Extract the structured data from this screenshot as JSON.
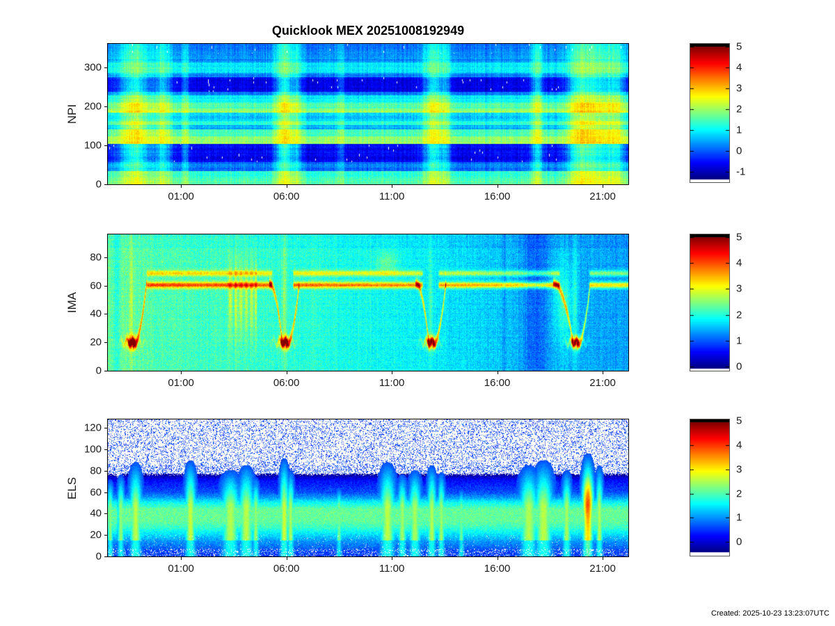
{
  "title": "Quicklook MEX 20251008192949",
  "created": "Created: 2025-10-23 13:23:07UTC",
  "time_axis": {
    "start_hours": -2.47,
    "end_hours": 22.22,
    "ticks": [
      {
        "t": 1,
        "label": "01:00"
      },
      {
        "t": 6,
        "label": "06:00"
      },
      {
        "t": 11,
        "label": "11:00"
      },
      {
        "t": 16,
        "label": "16:00"
      },
      {
        "t": 21,
        "label": "21:00"
      }
    ]
  },
  "chart_data": [
    {
      "type": "heatmap",
      "ylabel": "NPI",
      "y_range": [
        0,
        360
      ],
      "y_ticks": [
        0,
        100,
        200,
        300
      ],
      "colorbar": {
        "vmin": -1.5,
        "vmax": 5.15,
        "cap_hi": 5.0,
        "cap_lo": -1.36,
        "ticks": [
          5,
          4,
          3,
          2,
          1,
          0,
          -1
        ],
        "colormap": "jet",
        "over_color": "#000000",
        "under_color": "#ffffff"
      },
      "render": {
        "kind": "npi",
        "bands": [
          [
            0,
            17,
            1.45
          ],
          [
            17,
            34,
            1.2
          ],
          [
            34,
            57,
            0.1
          ],
          [
            57,
            103,
            -0.75
          ],
          [
            103,
            123,
            2.0
          ],
          [
            123,
            140,
            1.5
          ],
          [
            140,
            151,
            0.45
          ],
          [
            151,
            163,
            1.3
          ],
          [
            163,
            183,
            0.6
          ],
          [
            183,
            194,
            1.9
          ],
          [
            194,
            211,
            1.5
          ],
          [
            211,
            228,
            0.9
          ],
          [
            228,
            237,
            0.0
          ],
          [
            237,
            274,
            -0.8
          ],
          [
            274,
            286,
            0.2
          ],
          [
            286,
            311,
            0.9
          ],
          [
            311,
            346,
            0.25
          ],
          [
            346,
            360,
            0.05
          ]
        ],
        "events": [
          {
            "t": -1.2,
            "w": 0.55,
            "s": 1.5
          },
          {
            "t": 0.15,
            "w": 0.28,
            "s": 1.1
          },
          {
            "t": 1.2,
            "w": 0.12,
            "s": 0.8
          },
          {
            "t": 5.9,
            "w": 0.3,
            "s": 1.5
          },
          {
            "t": 6.5,
            "w": 0.16,
            "s": 0.8
          },
          {
            "t": 8.6,
            "w": 0.12,
            "s": 0.6
          },
          {
            "t": 13.0,
            "w": 0.35,
            "s": 1.4
          },
          {
            "t": 13.6,
            "w": 0.14,
            "s": 0.7
          },
          {
            "t": 17.9,
            "w": 0.22,
            "s": 1.1
          },
          {
            "t": 19.9,
            "w": 0.45,
            "s": 1.5
          },
          {
            "t": 20.9,
            "w": 0.5,
            "s": 1.2
          },
          {
            "t": 21.7,
            "w": 0.3,
            "s": 1.0
          }
        ]
      }
    },
    {
      "type": "heatmap",
      "ylabel": "IMA",
      "y_range": [
        0,
        96
      ],
      "y_ticks": [
        0,
        20,
        40,
        60,
        80
      ],
      "colorbar": {
        "vmin": -0.15,
        "vmax": 5.1,
        "cap_hi": 5.0,
        "cap_lo": -0.07,
        "ticks": [
          5,
          4,
          3,
          2,
          1,
          0
        ],
        "colormap": "jet",
        "over_color": "#000000",
        "under_color": "#ffffff"
      },
      "render": {
        "kind": "ima",
        "bg": [
          [
            -2.47,
            2.35
          ],
          [
            -1.6,
            2.3
          ],
          [
            0,
            2.2
          ],
          [
            6,
            2.05
          ],
          [
            12,
            1.8
          ],
          [
            16,
            1.55
          ],
          [
            19,
            1.45
          ],
          [
            22.22,
            1.3
          ]
        ],
        "beam_segments": [
          [
            -0.65,
            5.35
          ],
          [
            6.3,
            12.5
          ],
          [
            13.2,
            19.0
          ],
          [
            20.35,
            22.3
          ]
        ],
        "beam_lines": [
          {
            "ch": 68.6,
            "amp": 1.15,
            "sig": 1.4
          },
          {
            "ch": 60.3,
            "amp": 1.95,
            "sig": 1.5
          }
        ],
        "periapsis": [
          {
            "t": -1.35,
            "sides": "r"
          },
          {
            "t": 5.9,
            "sides": "lr"
          },
          {
            "t": 12.85,
            "sides": "lr"
          },
          {
            "t": 19.7,
            "sides": "lr",
            "wide": true
          }
        ],
        "streaks": [
          {
            "t": 3.35,
            "w": 0.06
          },
          {
            "t": 3.6,
            "w": 0.05
          },
          {
            "t": 3.85,
            "w": 0.07
          },
          {
            "t": 4.1,
            "w": 0.05
          },
          {
            "t": 4.35,
            "w": 0.06
          },
          {
            "t": 4.55,
            "w": 0.04
          }
        ],
        "bump": {
          "t": 10.75,
          "w": 0.4,
          "ch": 76,
          "amp": 0.5
        },
        "dark_cols": [
          {
            "t": -2.05,
            "w": 0.1,
            "d": -0.35
          },
          {
            "t": 16.35,
            "w": 0.1,
            "d": -0.25
          },
          {
            "t": 17.8,
            "w": 0.45,
            "d": -0.5
          }
        ]
      }
    },
    {
      "type": "heatmap",
      "ylabel": "ELS",
      "y_range": [
        0,
        128
      ],
      "y_ticks": [
        0,
        20,
        40,
        60,
        80,
        100,
        120
      ],
      "colorbar": {
        "vmin": -0.57,
        "vmax": 5.06,
        "cap_hi": 4.94,
        "cap_lo": -0.44,
        "ticks": [
          5,
          4,
          3,
          2,
          1,
          0
        ],
        "colormap": "jet",
        "over_color": "#000000",
        "under_color": "#ffffff"
      },
      "render": {
        "kind": "els",
        "profile": [
          [
            0,
            0.45
          ],
          [
            5,
            0.5
          ],
          [
            9,
            0.75
          ],
          [
            14,
            0.95
          ],
          [
            20,
            1.35
          ],
          [
            27,
            1.85
          ],
          [
            33,
            2.1
          ],
          [
            44,
            2.1
          ],
          [
            50,
            1.6
          ],
          [
            55,
            1.0
          ],
          [
            60,
            0.55
          ],
          [
            66,
            0.35
          ],
          [
            71,
            0.15
          ],
          [
            75,
            -0.25
          ],
          [
            79,
            -0.8
          ],
          [
            128,
            -1.05
          ]
        ],
        "plumes": [
          {
            "t": -2.35,
            "w": 0.1,
            "top": 70,
            "s": 1.1
          },
          {
            "t": -1.85,
            "w": 0.12,
            "top": 75,
            "s": 1.2
          },
          {
            "t": -1.15,
            "w": 0.2,
            "top": 88,
            "s": 1.6
          },
          {
            "t": 1.45,
            "w": 0.18,
            "top": 90,
            "s": 1.7
          },
          {
            "t": 3.35,
            "w": 0.3,
            "top": 80,
            "s": 1.5
          },
          {
            "t": 4.1,
            "w": 0.25,
            "top": 85,
            "s": 1.6
          },
          {
            "t": 4.55,
            "w": 0.12,
            "top": 72,
            "s": 1.2
          },
          {
            "t": 5.9,
            "w": 0.15,
            "top": 92,
            "s": 1.8
          },
          {
            "t": 6.2,
            "w": 0.12,
            "top": 80,
            "s": 1.4
          },
          {
            "t": 8.5,
            "w": 0.1,
            "top": 62,
            "s": 0.9
          },
          {
            "t": 10.8,
            "w": 0.25,
            "top": 88,
            "s": 1.6
          },
          {
            "t": 11.5,
            "w": 0.15,
            "top": 75,
            "s": 1.3
          },
          {
            "t": 12.1,
            "w": 0.2,
            "top": 80,
            "s": 1.4
          },
          {
            "t": 12.9,
            "w": 0.15,
            "top": 85,
            "s": 1.5
          },
          {
            "t": 13.35,
            "w": 0.12,
            "top": 78,
            "s": 1.3
          },
          {
            "t": 14.3,
            "w": 0.1,
            "top": 60,
            "s": 0.8
          },
          {
            "t": 17.5,
            "w": 0.3,
            "top": 85,
            "s": 1.5
          },
          {
            "t": 18.2,
            "w": 0.3,
            "top": 90,
            "s": 1.6
          },
          {
            "t": 19.3,
            "w": 0.15,
            "top": 80,
            "s": 1.4
          },
          {
            "t": 20.3,
            "w": 0.18,
            "top": 96,
            "s": 2.6
          },
          {
            "t": 20.85,
            "w": 0.12,
            "top": 85,
            "s": 1.5
          }
        ],
        "dark_cols": [
          {
            "t": -1.95,
            "w": 0.05,
            "d": -0.85
          }
        ]
      }
    }
  ]
}
